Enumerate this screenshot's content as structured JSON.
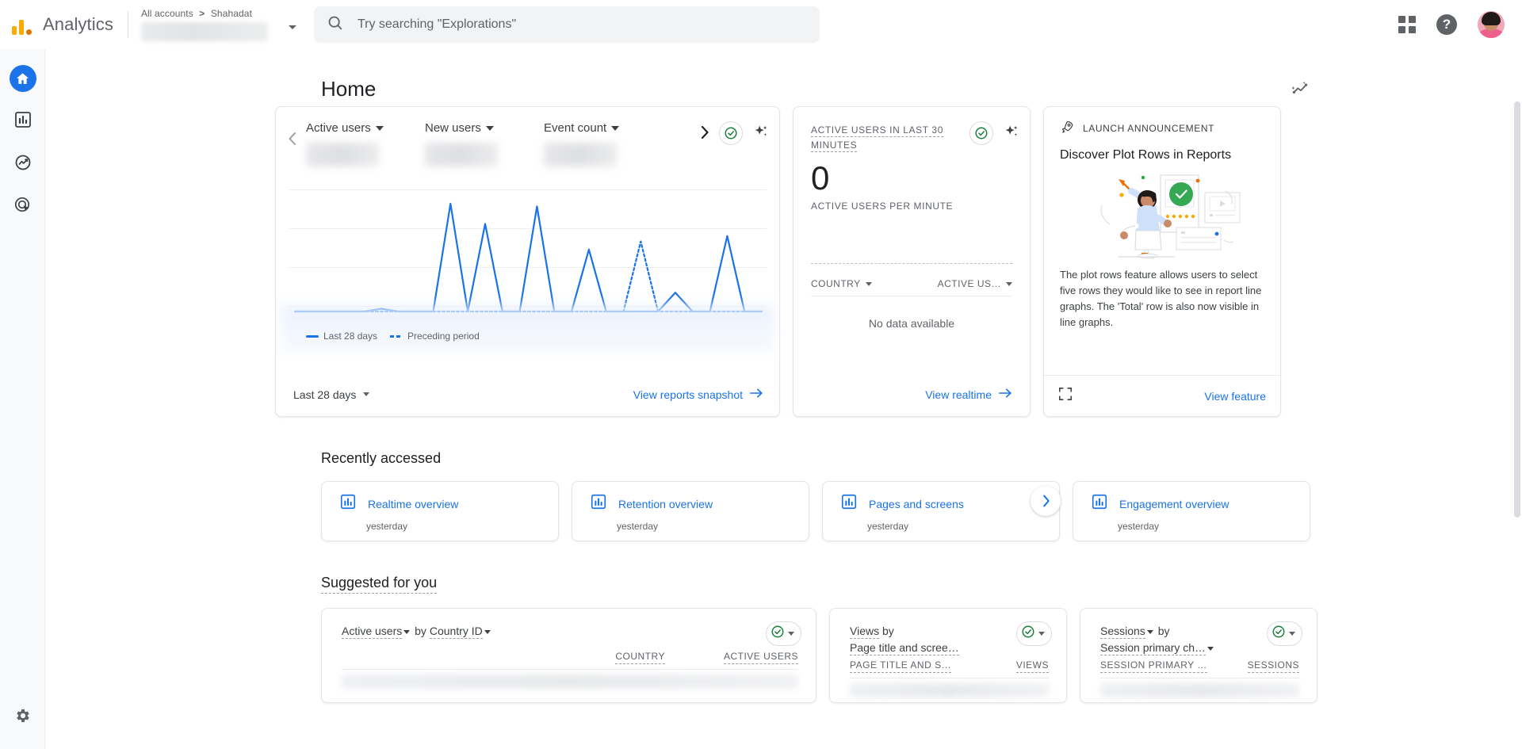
{
  "header": {
    "brand": "Analytics",
    "breadcrumb_all": "All accounts",
    "breadcrumb_sep": ">",
    "breadcrumb_account": "Shahadat",
    "search_placeholder": "Try searching \"Explorations\"",
    "search_value": "",
    "icons": {
      "search": "search-icon",
      "apps": "apps-grid-icon",
      "help": "help-icon",
      "avatar": "user-avatar"
    }
  },
  "sidebar": {
    "items": [
      {
        "name": "home",
        "label": "Home",
        "icon": "home-icon",
        "active": true
      },
      {
        "name": "reports",
        "label": "Reports",
        "icon": "bar-chart-icon",
        "active": false
      },
      {
        "name": "explore",
        "label": "Explore",
        "icon": "explore-trend-icon",
        "active": false
      },
      {
        "name": "advertising",
        "label": "Advertising",
        "icon": "advertising-target-icon",
        "active": false
      }
    ],
    "settings": {
      "name": "admin",
      "label": "Admin",
      "icon": "gear-icon"
    }
  },
  "page": {
    "title": "Home",
    "insights_icon": "insights-sparkle-icon"
  },
  "metrics_card": {
    "prev_arrow": "chevron-left-icon",
    "next_arrow": "chevron-right-icon",
    "metrics": [
      {
        "label": "Active users",
        "value_hidden": true
      },
      {
        "label": "New users",
        "value_hidden": true
      },
      {
        "label": "Event count",
        "value_hidden": true
      }
    ],
    "check_icon": "check-circle-icon",
    "ai_icon": "sparkle-icon",
    "legend": [
      {
        "label": "Last 28 days",
        "style": "solid",
        "color": "#1a73e8"
      },
      {
        "label": "Preceding period",
        "style": "dashed",
        "color": "#1a73e8"
      }
    ],
    "date_range": "Last 28 days",
    "footer_link": "View reports snapshot",
    "footer_arrow": "arrow-right-icon"
  },
  "chart_data": {
    "type": "line",
    "title": "Active users",
    "xlabel": "",
    "ylabel": "",
    "grid": true,
    "legend_position": "bottom-left",
    "ylim": [
      0,
      10
    ],
    "series": [
      {
        "name": "Last 28 days",
        "style": "solid",
        "color": "#1a73e8",
        "values": [
          0,
          0,
          0,
          0,
          0,
          0.2,
          0,
          0,
          0,
          8,
          0,
          6.5,
          0,
          0,
          7.8,
          0,
          0,
          4.6,
          0,
          0,
          0,
          0,
          1.4,
          0,
          0,
          5.6,
          0,
          0
        ]
      },
      {
        "name": "Preceding period",
        "style": "dashed",
        "color": "#1a73e8",
        "values": [
          0,
          0,
          0,
          0,
          0,
          0,
          0,
          0,
          0,
          0,
          0,
          0,
          0,
          0,
          0,
          0,
          0,
          0,
          0,
          0,
          5.2,
          0,
          0,
          0,
          0,
          0,
          0,
          0
        ]
      }
    ]
  },
  "realtime_card": {
    "label": "ACTIVE USERS IN LAST 30 MINUTES",
    "value": "0",
    "sub_label": "ACTIVE USERS PER MINUTE",
    "columns": [
      "COUNTRY",
      "ACTIVE US…"
    ],
    "empty_text": "No data available",
    "footer_link": "View realtime",
    "footer_arrow": "arrow-right-icon",
    "check_icon": "check-circle-icon",
    "ai_icon": "sparkle-icon"
  },
  "announcement_card": {
    "kicker": "LAUNCH ANNOUNCEMENT",
    "kicker_icon": "rocket-icon",
    "title": "Discover Plot Rows in Reports",
    "body": "The plot rows feature allows users to select five rows they would like to see in report line graphs. The 'Total' row is also now visible in line graphs.",
    "expand_icon": "expand-icon",
    "footer_link": "View feature"
  },
  "recently_accessed": {
    "title": "Recently accessed",
    "next_arrow": "chevron-right-icon",
    "items": [
      {
        "name": "Realtime overview",
        "time": "yesterday",
        "icon": "report-icon"
      },
      {
        "name": "Retention overview",
        "time": "yesterday",
        "icon": "report-icon"
      },
      {
        "name": "Pages and screens",
        "time": "yesterday",
        "icon": "report-icon"
      },
      {
        "name": "Engagement overview",
        "time": "yesterday",
        "icon": "report-icon"
      }
    ]
  },
  "suggested": {
    "title": "Suggested for you",
    "cards": [
      {
        "metric": "Active users",
        "by": "by",
        "dimension": "Country ID",
        "columns": [
          "COUNTRY",
          "ACTIVE USERS"
        ],
        "check_icon": "check-circle-icon"
      },
      {
        "metric": "Views",
        "by": "by",
        "dimension": "Page title and scree…",
        "columns": [
          "PAGE TITLE AND S…",
          "VIEWS"
        ],
        "check_icon": "check-circle-icon"
      },
      {
        "metric": "Sessions",
        "by": "by",
        "dimension": "Session primary ch…",
        "columns": [
          "SESSION PRIMARY …",
          "SESSIONS"
        ],
        "check_icon": "check-circle-icon"
      }
    ]
  },
  "colors": {
    "accent_blue": "#1a73e8",
    "brand_orange": "#f9ab00",
    "brand_orange_dark": "#e37400",
    "check_green": "#188038",
    "text_primary": "#202124",
    "text_secondary": "#5f6368"
  }
}
